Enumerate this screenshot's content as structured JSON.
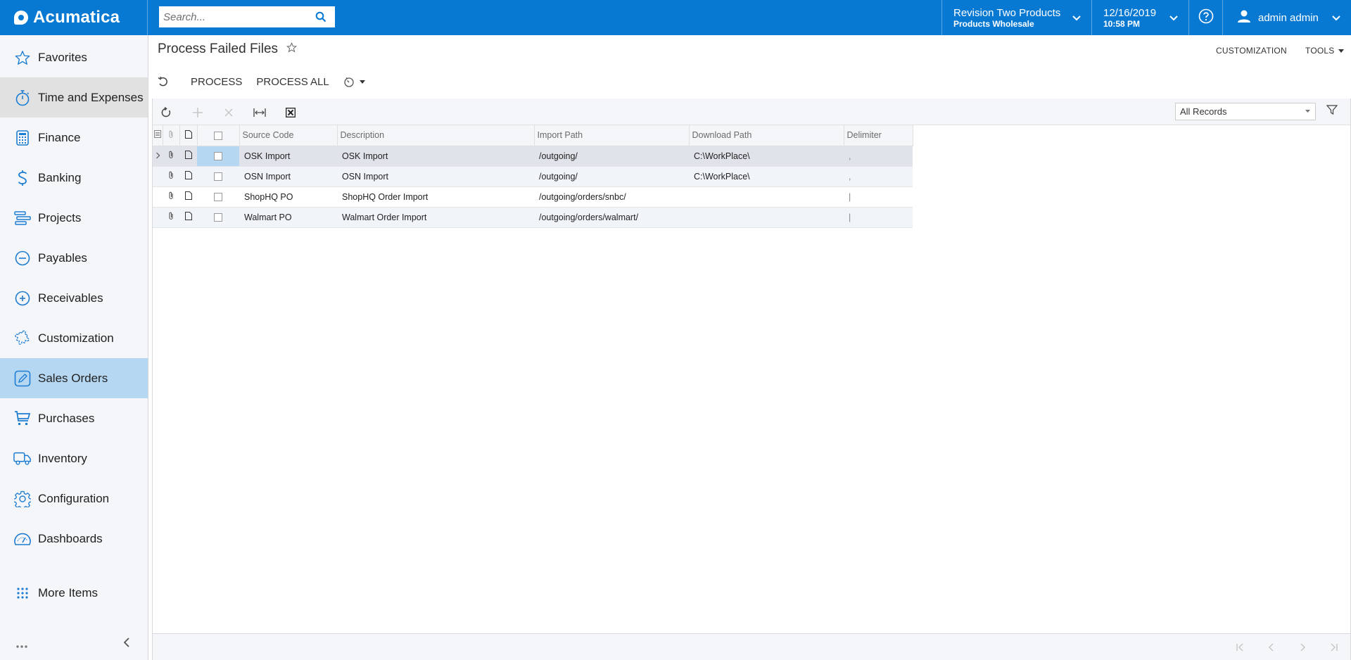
{
  "app": {
    "brand": "Acumatica",
    "search_placeholder": "Search...",
    "branch": {
      "company": "Revision Two Products",
      "branch": "Products Wholesale"
    },
    "datetime": {
      "date": "12/16/2019",
      "time": "10:58 PM"
    },
    "user": "admin admin"
  },
  "sidebar": {
    "items": [
      {
        "label": "Favorites",
        "icon": "star-icon",
        "state": ""
      },
      {
        "label": "Time and Expenses",
        "icon": "stopwatch-icon",
        "state": "hover"
      },
      {
        "label": "Finance",
        "icon": "calculator-icon",
        "state": ""
      },
      {
        "label": "Banking",
        "icon": "dollar-icon",
        "state": ""
      },
      {
        "label": "Projects",
        "icon": "gantt-icon",
        "state": ""
      },
      {
        "label": "Payables",
        "icon": "minus-circle-icon",
        "state": ""
      },
      {
        "label": "Receivables",
        "icon": "plus-circle-icon",
        "state": ""
      },
      {
        "label": "Customization",
        "icon": "puzzle-icon",
        "state": ""
      },
      {
        "label": "Sales Orders",
        "icon": "pencil-square-icon",
        "state": "active"
      },
      {
        "label": "Purchases",
        "icon": "cart-icon",
        "state": ""
      },
      {
        "label": "Inventory",
        "icon": "truck-icon",
        "state": ""
      },
      {
        "label": "Configuration",
        "icon": "gear-icon",
        "state": ""
      },
      {
        "label": "Dashboards",
        "icon": "gauge-icon",
        "state": ""
      },
      {
        "label": "More Items",
        "icon": "grid-dots-icon",
        "state": ""
      }
    ]
  },
  "page": {
    "title": "Process Failed Files",
    "header_links": {
      "customization": "CUSTOMIZATION",
      "tools": "TOOLS"
    },
    "actions": {
      "process": "PROCESS",
      "process_all": "PROCESS ALL"
    }
  },
  "grid": {
    "filter": "All Records",
    "columns": [
      "Source Code",
      "Description",
      "Import Path",
      "Download Path",
      "Delimiter"
    ],
    "rows": [
      {
        "source_code": "OSK Import",
        "description": "OSK Import",
        "import_path": "/outgoing/",
        "download_path": "C:\\WorkPlace\\",
        "delimiter": ",",
        "selected": true
      },
      {
        "source_code": "OSN Import",
        "description": "OSN Import",
        "import_path": "/outgoing/",
        "download_path": "C:\\WorkPlace\\",
        "delimiter": ",",
        "selected": false
      },
      {
        "source_code": "ShopHQ PO",
        "description": "ShopHQ Order Import",
        "import_path": "/outgoing/orders/snbc/",
        "download_path": "",
        "delimiter": "|",
        "selected": false
      },
      {
        "source_code": "Walmart PO",
        "description": "Walmart Order Import",
        "import_path": "/outgoing/orders/walmart/",
        "download_path": "",
        "delimiter": "|",
        "selected": false
      }
    ]
  },
  "colors": {
    "brand": "#0779d3",
    "active_nav": "#b6d7f1",
    "icon_blue": "#1d7dd3"
  }
}
